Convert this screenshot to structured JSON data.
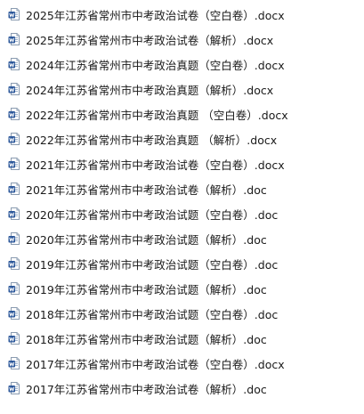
{
  "files": [
    {
      "name": "2025年江苏省常州市中考政治试卷（空白卷）.docx",
      "icon": "word-doc-icon"
    },
    {
      "name": "2025年江苏省常州市中考政治试卷（解析）.docx",
      "icon": "word-doc-icon"
    },
    {
      "name": "2024年江苏省常州市中考政治真题（空白卷）.docx",
      "icon": "word-doc-icon"
    },
    {
      "name": "2024年江苏省常州市中考政治真题（解析）.docx",
      "icon": "word-doc-icon"
    },
    {
      "name": "2022年江苏省常州市中考政治真题 （空白卷）.docx",
      "icon": "word-doc-icon"
    },
    {
      "name": "2022年江苏省常州市中考政治真题 （解析）.docx",
      "icon": "word-doc-icon"
    },
    {
      "name": "2021年江苏省常州市中考政治试卷（空白卷）.docx",
      "icon": "word-doc-icon"
    },
    {
      "name": "2021年江苏省常州市中考政治试卷（解析）.doc",
      "icon": "word-doc-icon"
    },
    {
      "name": "2020年江苏省常州市中考政治试题（空白卷）.doc",
      "icon": "word-doc-icon"
    },
    {
      "name": "2020年江苏省常州市中考政治试题（解析）.doc",
      "icon": "word-doc-icon"
    },
    {
      "name": "2019年江苏省常州市中考政治试题（空白卷）.doc",
      "icon": "word-doc-icon"
    },
    {
      "name": "2019年江苏省常州市中考政治试题（解析）.doc",
      "icon": "word-doc-icon"
    },
    {
      "name": "2018年江苏省常州市中考政治试题（空白卷）.doc",
      "icon": "word-doc-icon"
    },
    {
      "name": "2018年江苏省常州市中考政治试题（解析）.doc",
      "icon": "word-doc-icon"
    },
    {
      "name": "2017年江苏省常州市中考政治试卷（空白卷）.docx",
      "icon": "word-doc-icon"
    },
    {
      "name": "2017年江苏省常州市中考政治试卷（解析）.doc",
      "icon": "word-doc-icon"
    }
  ]
}
